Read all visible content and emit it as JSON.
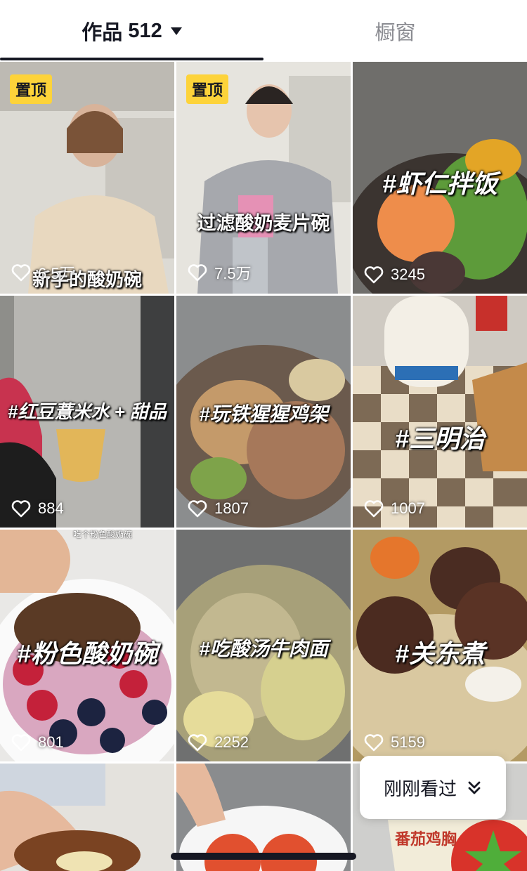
{
  "tabs": {
    "works_label": "作品",
    "works_count": "512",
    "window_label": "橱窗"
  },
  "pin_label": "置顶",
  "videos": [
    {
      "caption": "新手的酸奶碗",
      "likes": "6.5万",
      "pinned": true,
      "theme": "person-beige"
    },
    {
      "caption": "过滤酸奶麦片碗",
      "likes": "7.5万",
      "pinned": true,
      "theme": "person-grey"
    },
    {
      "caption": "#虾仁拌饭",
      "likes": "3245",
      "pinned": false,
      "theme": "shrimp-rice"
    },
    {
      "caption": "#红豆薏米水 + 甜品",
      "likes": "884",
      "pinned": false,
      "theme": "drink"
    },
    {
      "caption": "#玩铁猩猩鸡架",
      "likes": "1807",
      "pinned": false,
      "theme": "chicken"
    },
    {
      "caption": "#三明治",
      "likes": "1007",
      "pinned": false,
      "theme": "sandwich"
    },
    {
      "caption": "#粉色酸奶碗",
      "likes": "801",
      "pinned": false,
      "theme": "berry-bowl"
    },
    {
      "caption": "#吃酸汤牛肉面",
      "likes": "2252",
      "pinned": false,
      "theme": "noodles"
    },
    {
      "caption": "#关东煮",
      "likes": "5159",
      "pinned": false,
      "theme": "oden"
    },
    {
      "caption": "",
      "likes": "",
      "pinned": false,
      "theme": "pastry"
    },
    {
      "caption": "",
      "likes": "",
      "pinned": false,
      "theme": "tomato"
    },
    {
      "caption": "",
      "likes": "",
      "pinned": false,
      "theme": "package"
    }
  ],
  "small_overlay_text": "吃个粉色酸奶碗",
  "package_text": "番茄鸡胸",
  "recent_label": "刚刚看过",
  "icons": [
    "heart-icon",
    "caret-down-icon",
    "chevron-double-down-icon"
  ],
  "colors": {
    "pin": "#fdd33a",
    "text": "#161823",
    "muted": "#8a8b91"
  }
}
